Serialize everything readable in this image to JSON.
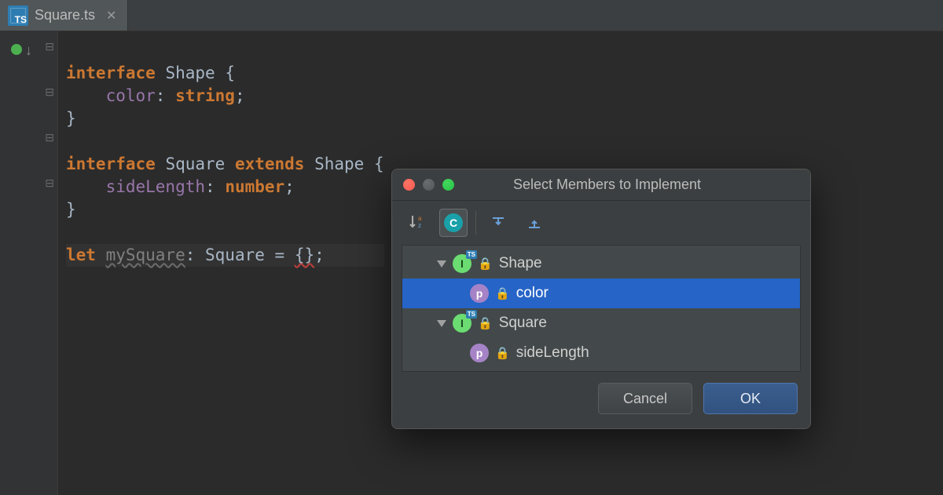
{
  "tab": {
    "filename": "Square.ts",
    "badge": "TS"
  },
  "code": {
    "l1a": "interface",
    "l1b": " Shape ",
    "l1c": "{",
    "l2a": "    ",
    "l2b": "color",
    "l2c": ": ",
    "l2d": "string",
    "l2e": ";",
    "l3a": "}",
    "l5a": "interface",
    "l5b": " Square ",
    "l5c": "extends",
    "l5d": " Shape ",
    "l5e": "{",
    "l6a": "    ",
    "l6b": "sideLength",
    "l6c": ": ",
    "l6d": "number",
    "l6e": ";",
    "l7a": "}",
    "l9a": "let ",
    "l9b": "mySquare",
    "l9c": ": Square = ",
    "l9d": "{}",
    "l9e": ";"
  },
  "dialog": {
    "title": "Select Members to Implement",
    "toolbar": {
      "sort_az": "↓",
      "sort_az_sub": "a z",
      "c_btn": "C"
    },
    "tree": [
      {
        "kind": "interface",
        "label": "Shape"
      },
      {
        "kind": "property",
        "label": "color",
        "selected": true
      },
      {
        "kind": "interface",
        "label": "Square"
      },
      {
        "kind": "property",
        "label": "sideLength"
      }
    ],
    "buttons": {
      "cancel": "Cancel",
      "ok": "OK"
    }
  }
}
